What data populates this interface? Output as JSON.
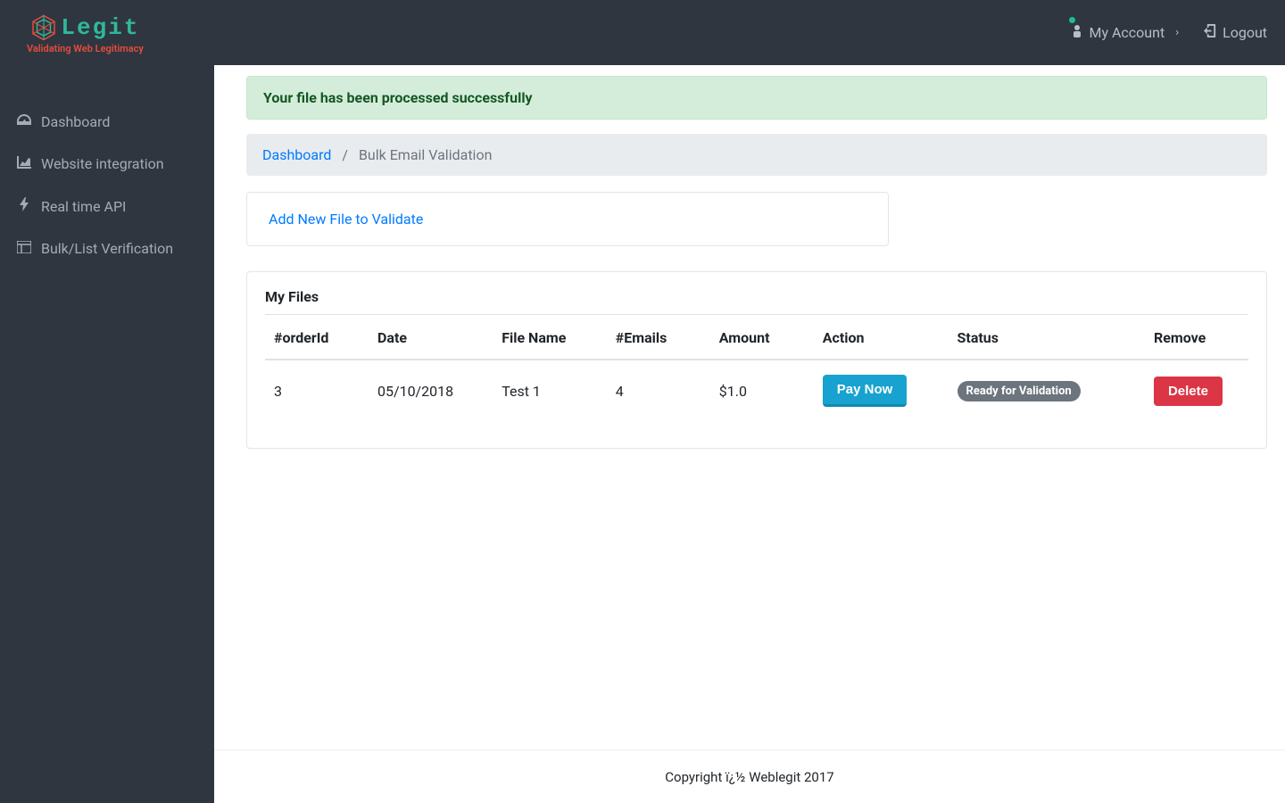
{
  "brand": {
    "name": "Legit",
    "tagline": "Validating Web Legitimacy"
  },
  "topbar": {
    "account_label": "My Account",
    "logout_label": "Logout"
  },
  "sidebar": {
    "items": [
      {
        "label": "Dashboard"
      },
      {
        "label": "Website integration"
      },
      {
        "label": "Real time API"
      },
      {
        "label": "Bulk/List Verification"
      }
    ]
  },
  "alert": {
    "message": "Your file has been processed successfully"
  },
  "breadcrumb": {
    "root": "Dashboard",
    "current": "Bulk Email Validation",
    "sep": "/"
  },
  "add_link": {
    "label": "Add New File to Validate"
  },
  "panel": {
    "title": "My Files",
    "columns": {
      "orderId": "#orderId",
      "date": "Date",
      "fileName": "File Name",
      "emails": "#Emails",
      "amount": "Amount",
      "action": "Action",
      "status": "Status",
      "remove": "Remove"
    },
    "rows": [
      {
        "orderId": "3",
        "date": "05/10/2018",
        "fileName": "Test 1",
        "emails": "4",
        "amount": "$1.0",
        "action_label": "Pay Now",
        "status_label": "Ready for Validation",
        "remove_label": "Delete"
      }
    ]
  },
  "footer": {
    "text": "Copyright ï¿½ Weblegit 2017"
  }
}
